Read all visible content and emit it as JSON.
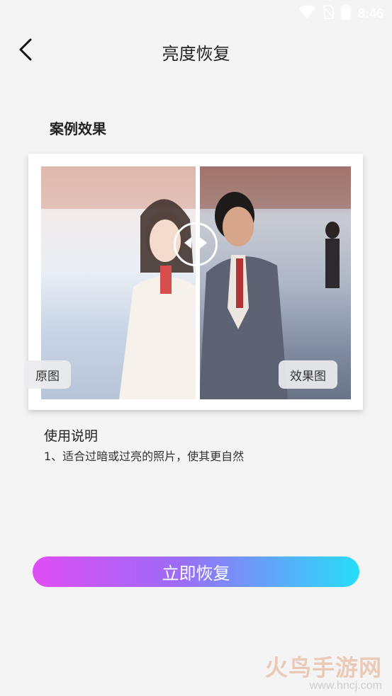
{
  "status": {
    "time": "8:46",
    "icons": [
      "wifi-icon",
      "no-sim-icon",
      "battery-icon"
    ]
  },
  "header": {
    "title": "亮度恢复",
    "back_icon": "chevron-left-icon"
  },
  "example": {
    "section_title": "案例效果",
    "label_original": "原图",
    "label_result": "效果图",
    "handle_icon": "compare-arrows-icon"
  },
  "usage": {
    "title": "使用说明",
    "line1": "1、适合过暗或过亮的照片，使其更自然"
  },
  "action": {
    "restore_label": "立即恢复"
  },
  "watermark": {
    "main": "火鸟手游网",
    "sub": "www.hncj.com"
  },
  "colors": {
    "button_gradient_start": "#e04df5",
    "button_gradient_end": "#27ddf8",
    "background": "#f4f4f4"
  }
}
